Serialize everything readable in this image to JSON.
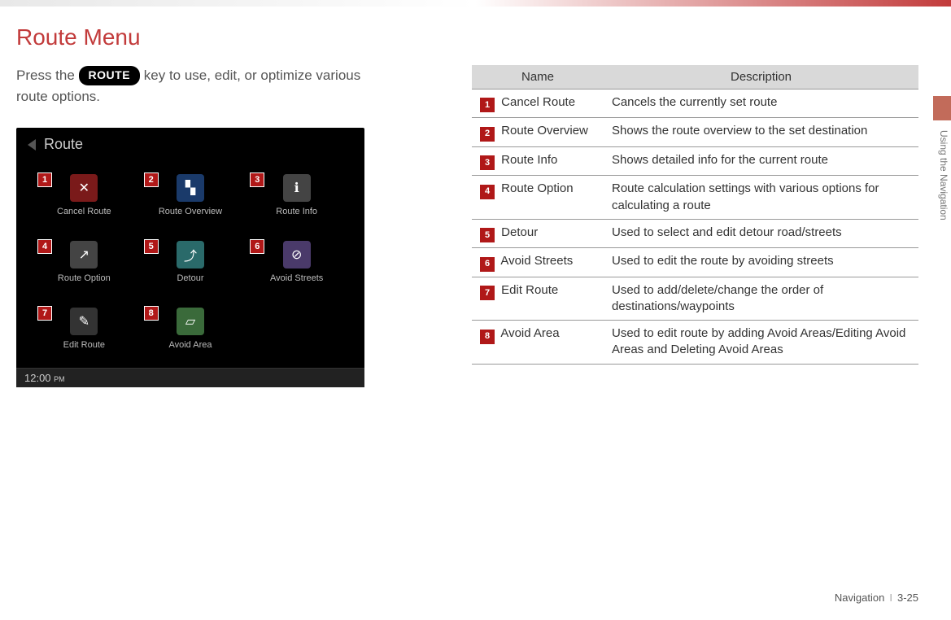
{
  "page_title": "Route Menu",
  "intro_before": "Press the ",
  "keycap": "ROUTE",
  "intro_after": " key to use, edit, or optimize various route options.",
  "screenshot": {
    "header_title": "Route",
    "clock": "12:00",
    "clock_suffix": "PM",
    "tiles": [
      {
        "num": "1",
        "label": "Cancel Route",
        "icon": "✕",
        "cls": "ic-red"
      },
      {
        "num": "2",
        "label": "Route Overview",
        "icon": "▚",
        "cls": "ic-blue"
      },
      {
        "num": "3",
        "label": "Route Info",
        "icon": "ℹ",
        "cls": "ic-gray"
      },
      {
        "num": "4",
        "label": "Route Option",
        "icon": "↗",
        "cls": "ic-gray"
      },
      {
        "num": "5",
        "label": "Detour",
        "icon": "⤴",
        "cls": "ic-teal"
      },
      {
        "num": "6",
        "label": "Avoid Streets",
        "icon": "⊘",
        "cls": "ic-purple"
      },
      {
        "num": "7",
        "label": "Edit Route",
        "icon": "✎",
        "cls": "ic-dark"
      },
      {
        "num": "8",
        "label": "Avoid Area",
        "icon": "▱",
        "cls": "ic-green"
      }
    ]
  },
  "table": {
    "head_name": "Name",
    "head_desc": "Description",
    "rows": [
      {
        "num": "1",
        "name": "Cancel Route",
        "desc": "Cancels the currently set route"
      },
      {
        "num": "2",
        "name": "Route Overview",
        "desc": "Shows the route overview to the set destination"
      },
      {
        "num": "3",
        "name": "Route Info",
        "desc": "Shows detailed info for the current route"
      },
      {
        "num": "4",
        "name": "Route Option",
        "desc": "Route calculation settings with various options for calculating a route"
      },
      {
        "num": "5",
        "name": "Detour",
        "desc": "Used to select and edit detour road/streets"
      },
      {
        "num": "6",
        "name": "Avoid Streets",
        "desc": "Used to edit the route by avoiding streets"
      },
      {
        "num": "7",
        "name": "Edit Route",
        "desc": "Used to add/delete/change the order of destinations/waypoints"
      },
      {
        "num": "8",
        "name": "Avoid Area",
        "desc": "Used to edit route by adding Avoid Areas/Editing Avoid Areas and Deleting Avoid Areas"
      }
    ]
  },
  "side_label": "Using the Navigation",
  "footer_section": "Navigation",
  "footer_page": "3-25"
}
